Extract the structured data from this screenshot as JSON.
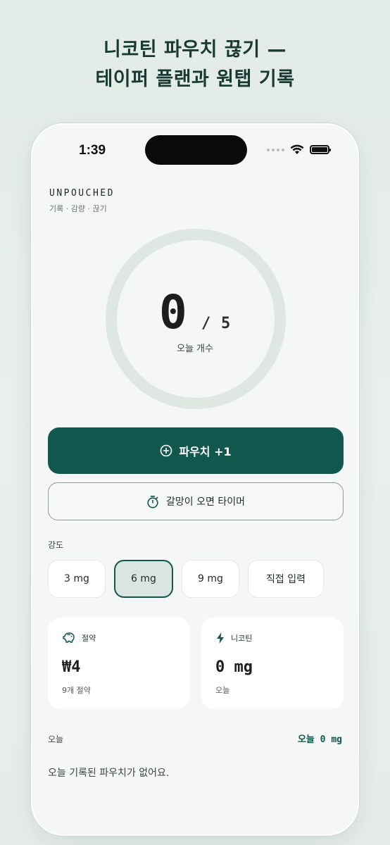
{
  "headline": {
    "line1": "니코틴 파우치 끊기 —",
    "line2": "테이퍼 플랜과 원탭 기록"
  },
  "status": {
    "time": "1:39"
  },
  "app": {
    "brand": "UNPOUCHED",
    "tagline": "기록 · 감량 · 끊기"
  },
  "counter": {
    "count": "0",
    "slash": "/",
    "goal": "5",
    "label": "오늘 개수",
    "progress": 0
  },
  "actions": {
    "add_pouch": "파우치 +1",
    "craving_timer": "갈망이 오면 타이머"
  },
  "strength": {
    "label": "강도",
    "options": [
      "3 mg",
      "6 mg",
      "9 mg",
      "직접 입력"
    ],
    "selected": "6 mg"
  },
  "cards": {
    "savings": {
      "title": "절약",
      "value": "₩4",
      "sub": "9개 절약",
      "icon": "piggy-bank-icon"
    },
    "nicotine": {
      "title": "니코틴",
      "value": "0 mg",
      "sub": "오늘",
      "icon": "bolt-icon"
    }
  },
  "today": {
    "label": "오늘",
    "total": "오늘 0 mg",
    "empty_message": "오늘 기록된 파우치가 없어요."
  },
  "colors": {
    "accent": "#12574d",
    "ring_track": "#dfe7e3",
    "background": "#f4f7f5"
  }
}
